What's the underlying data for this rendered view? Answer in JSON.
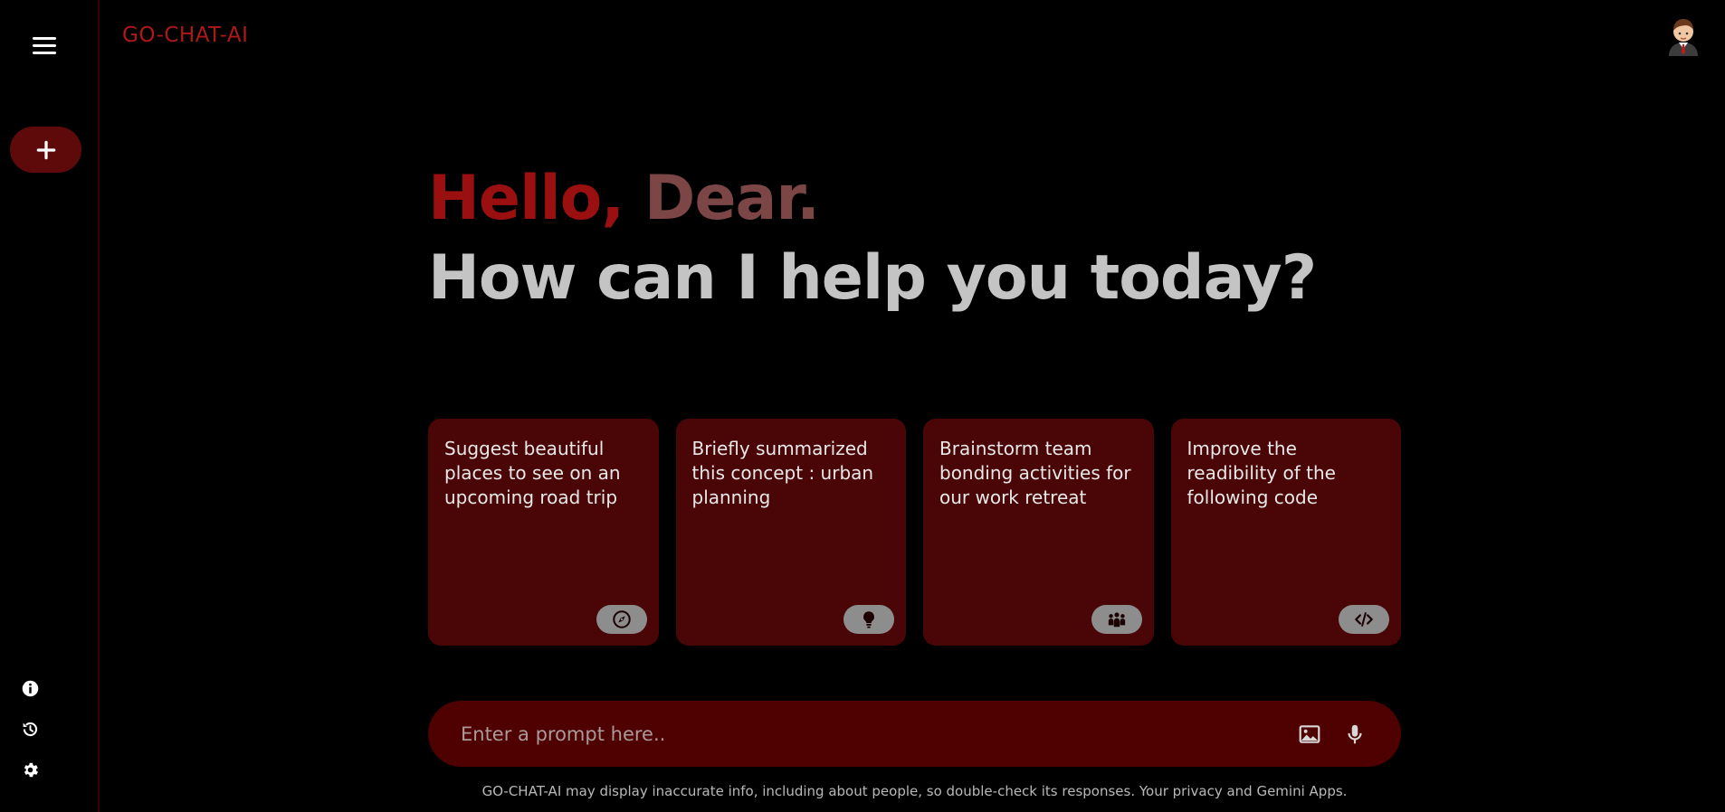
{
  "app": {
    "title": "GO-CHAT-AI"
  },
  "sidebar": {
    "menu_icon": "hamburger-icon",
    "new_chat_icon": "plus-icon",
    "bottom_items": [
      {
        "icon": "info-icon"
      },
      {
        "icon": "history-icon"
      },
      {
        "icon": "settings-icon"
      }
    ]
  },
  "header": {
    "avatar_icon": "user-avatar"
  },
  "greeting": {
    "hello": "Hello,",
    "name": " Dear.",
    "subtitle": "How can I help you today?"
  },
  "cards": [
    {
      "text": "Suggest beautiful places to see on an upcoming road trip",
      "icon": "compass-icon"
    },
    {
      "text": "Briefly summarized this concept : urban planning",
      "icon": "lightbulb-icon"
    },
    {
      "text": "Brainstorm team bonding activities for our work retreat",
      "icon": "people-icon"
    },
    {
      "text": "Improve the readibility of the following code",
      "icon": "code-icon"
    }
  ],
  "prompt": {
    "placeholder": "Enter a prompt here..",
    "value": "",
    "image_icon": "image-icon",
    "mic_icon": "microphone-icon"
  },
  "footer": {
    "text": "GO-CHAT-AI may display inaccurate info, including about people, so double-check its responses. Your privacy and Gemini Apps."
  },
  "colors": {
    "accent": "#9a1010",
    "card_bg": "#4a0607",
    "prompt_bg": "#4f0001",
    "background": "#000000"
  }
}
